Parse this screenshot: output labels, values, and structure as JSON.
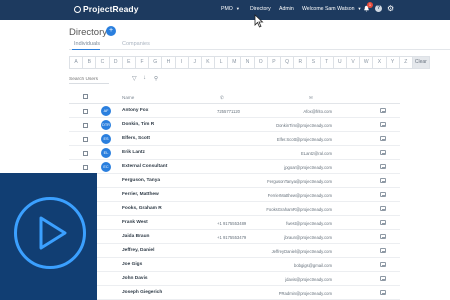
{
  "app": {
    "logo_text": "ProjectReady",
    "nav": {
      "pmo": "PMO",
      "directory": "Directory",
      "admin": "Admin",
      "welcome": "Welcome Sam Watson"
    },
    "notification_count": "1",
    "help": "?",
    "colors": {
      "topbar": "#1d3a5f",
      "accent": "#2a7fde",
      "overlay": "#113e73"
    }
  },
  "page": {
    "title": "Directory",
    "add_label": "+",
    "tabs": [
      "Individuals",
      "Companies"
    ]
  },
  "alphabet": [
    "A",
    "B",
    "C",
    "D",
    "E",
    "F",
    "G",
    "H",
    "I",
    "J",
    "K",
    "L",
    "M",
    "N",
    "O",
    "P",
    "Q",
    "R",
    "S",
    "T",
    "U",
    "V",
    "W",
    "X",
    "Y",
    "Z"
  ],
  "alphabet_clear": "Clear",
  "search": {
    "placeholder": "Search Users"
  },
  "table": {
    "headers": {
      "name": "Name"
    },
    "rows": [
      {
        "initials": "AF",
        "name": "Antony Fox",
        "phone": "7255771120",
        "email": "Afox@frito.com"
      },
      {
        "initials": "DTR",
        "name": "Donkin, Tim R",
        "phone": "",
        "email": "DonkinTim@projectready.com"
      },
      {
        "initials": "ES",
        "name": "Elfers, Scott",
        "phone": "",
        "email": "Elfer.Scott@projectready.com"
      },
      {
        "initials": "EL",
        "name": "Erik Lantz",
        "phone": "",
        "email": "ELantz@ral.com"
      },
      {
        "initials": "EC",
        "name": "External Consultant",
        "phone": "",
        "email": "jpgoar@projectready.com"
      },
      {
        "initials": "",
        "name": "Ferguson, Tanya",
        "phone": "",
        "email": "FergusonTanya@projectready.com"
      },
      {
        "initials": "",
        "name": "Ferrier, Matthew",
        "phone": "",
        "email": "FerrierMatthew@projectready.com"
      },
      {
        "initials": "",
        "name": "Fooks, Graham R",
        "phone": "",
        "email": "FooksGrahamR@projectready.com"
      },
      {
        "initials": "",
        "name": "Frank West",
        "phone": "+1 9175553489",
        "email": "fwest@projectready.com"
      },
      {
        "initials": "",
        "name": "Jaida Braun",
        "phone": "+1 9175553479",
        "email": "jbraun@projectready.com"
      },
      {
        "initials": "",
        "name": "Jeffrey, Daniel",
        "phone": "",
        "email": "JeffreyDaniel@projectready.com"
      },
      {
        "initials": "",
        "name": "Joe Gigs",
        "phone": "",
        "email": "bobgigs@gmail.com"
      },
      {
        "initials": "",
        "name": "John Davis",
        "phone": "",
        "email": "jdavis@projectready.com"
      },
      {
        "initials": "",
        "name": "Joseph Giegerich",
        "phone": "",
        "email": "PRadmin@projectready.com"
      }
    ]
  }
}
